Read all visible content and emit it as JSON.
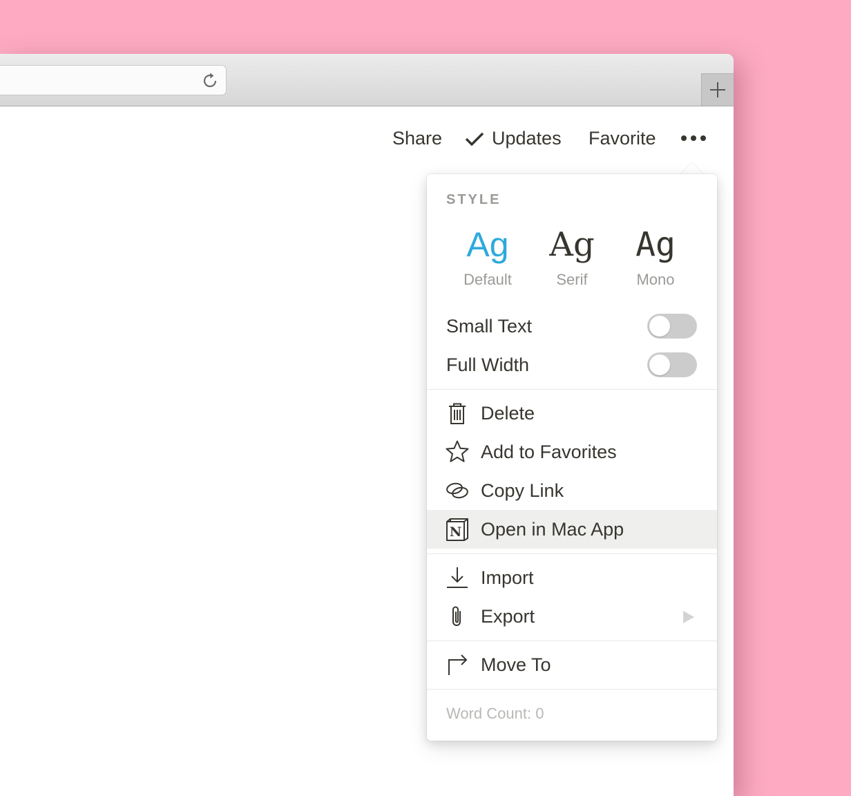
{
  "colors": {
    "background": "#fdaac2",
    "accent": "#2eaadc",
    "text": "#37352f",
    "muted": "#9b9a97",
    "toggle_off": "#cccccc",
    "highlight": "#efefee"
  },
  "browser": {
    "reload_icon": "reload-icon",
    "new_tab_icon": "plus-icon"
  },
  "topbar": {
    "share": "Share",
    "updates": "Updates",
    "favorite": "Favorite",
    "more_icon": "ellipsis-icon"
  },
  "menu": {
    "style_label": "STYLE",
    "styles": [
      {
        "sample": "Ag",
        "label": "Default",
        "selected": true
      },
      {
        "sample": "Ag",
        "label": "Serif",
        "selected": false
      },
      {
        "sample": "Ag",
        "label": "Mono",
        "selected": false
      }
    ],
    "toggles": [
      {
        "label": "Small Text",
        "on": false
      },
      {
        "label": "Full Width",
        "on": false
      }
    ],
    "items": [
      {
        "label": "Delete",
        "icon": "trash-icon"
      },
      {
        "label": "Add to Favorites",
        "icon": "star-icon"
      },
      {
        "label": "Copy Link",
        "icon": "link-icon"
      },
      {
        "label": "Open in Mac App",
        "icon": "notion-app-icon",
        "highlighted": true
      },
      {
        "label": "Import",
        "icon": "import-icon"
      },
      {
        "label": "Export",
        "icon": "paperclip-icon",
        "submenu": true
      },
      {
        "label": "Move To",
        "icon": "move-arrow-icon"
      }
    ],
    "word_count": "Word Count: 0"
  }
}
